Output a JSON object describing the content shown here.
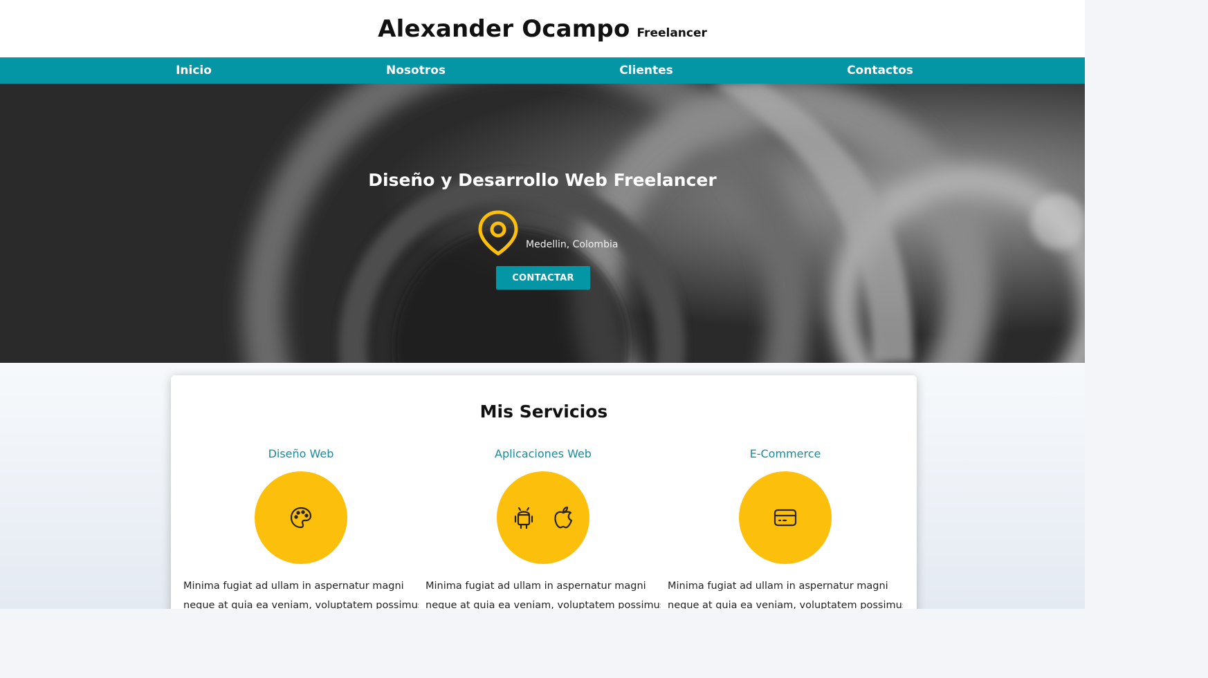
{
  "header": {
    "brand_name": "Alexander Ocampo",
    "brand_role": "Freelancer"
  },
  "nav": {
    "items": [
      "Inicio",
      "Nosotros",
      "Clientes",
      "Contactos"
    ]
  },
  "hero": {
    "title": "Diseño y Desarrollo Web Freelancer",
    "location": "Medellin, Colombia",
    "cta_label": "CONTACTAR"
  },
  "services": {
    "title": "Mis Servicios",
    "items": [
      {
        "title": "Diseño Web",
        "icons": [
          "palette-icon"
        ],
        "text_line1": "Minima fugiat ad ullam in aspernatur magni",
        "text_line2": "neque at quia ea veniam, voluptatem possimus"
      },
      {
        "title": "Aplicaciones Web",
        "icons": [
          "android-icon",
          "apple-icon"
        ],
        "text_line1": "Minima fugiat ad ullam in aspernatur magni",
        "text_line2": "neque at quia ea veniam, voluptatem possimus"
      },
      {
        "title": "E-Commerce",
        "icons": [
          "credit-card-icon"
        ],
        "text_line1": "Minima fugiat ad ullam in aspernatur magni",
        "text_line2": "neque at quia ea veniam, voluptatem possimus"
      }
    ]
  },
  "colors": {
    "accent": "#0596a6",
    "circle": "#fbbf0c",
    "pin": "#fbbf0c"
  }
}
